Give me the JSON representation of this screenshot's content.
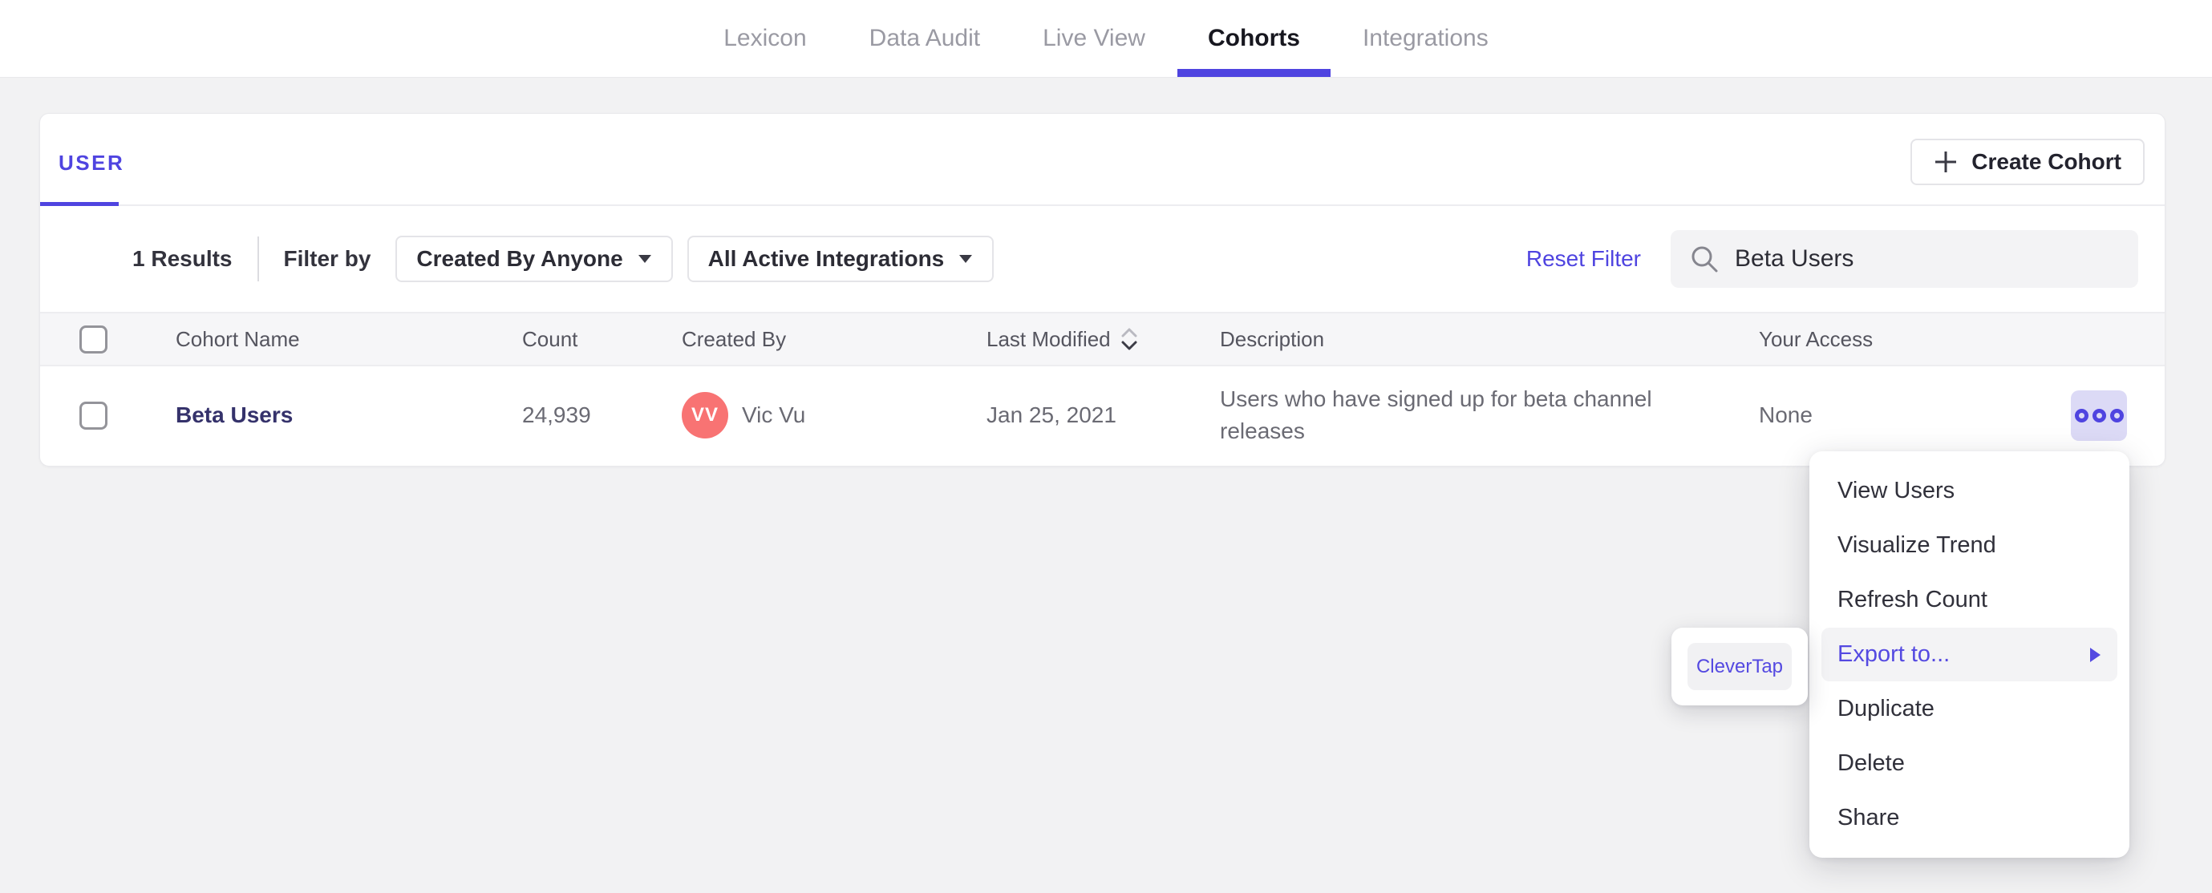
{
  "nav": {
    "items": [
      {
        "label": "Lexicon",
        "active": false
      },
      {
        "label": "Data Audit",
        "active": false
      },
      {
        "label": "Live View",
        "active": false
      },
      {
        "label": "Cohorts",
        "active": true
      },
      {
        "label": "Integrations",
        "active": false
      }
    ]
  },
  "cohorts_card": {
    "tab_label": "USER",
    "create_button_label": "Create Cohort",
    "filters": {
      "results_count": "1 Results",
      "filter_by_label": "Filter by",
      "created_by_dropdown_value": "Created By Anyone",
      "integrations_dropdown_value": "All Active Integrations",
      "reset_link_label": "Reset Filter",
      "search_value": "Beta Users"
    },
    "table": {
      "columns": [
        "Cohort Name",
        "Count",
        "Created By",
        "Last Modified",
        "Description",
        "Your Access"
      ],
      "sorted_column": "Last Modified",
      "rows": [
        {
          "name": "Beta Users",
          "count": "24,939",
          "created_by_initials": "VV",
          "created_by": "Vic Vu",
          "last_modified": "Jan 25, 2021",
          "description": "Users who have signed up for beta channel releases",
          "your_access": "None"
        }
      ]
    }
  },
  "context_menu": {
    "items": [
      "View Users",
      "Visualize Trend",
      "Refresh Count",
      "Export to...",
      "Duplicate",
      "Delete",
      "Share"
    ],
    "highlighted_item": "Export to...",
    "submenu": {
      "items": [
        "CleverTap"
      ]
    }
  },
  "colors": {
    "accent": "#4f44e0",
    "menu_highlight_text": "#5449e1",
    "cohort_link": "#35326b",
    "avatar_background": "#f87373",
    "more_button_background": "#dcdaf6",
    "page_background": "#f2f2f3"
  }
}
